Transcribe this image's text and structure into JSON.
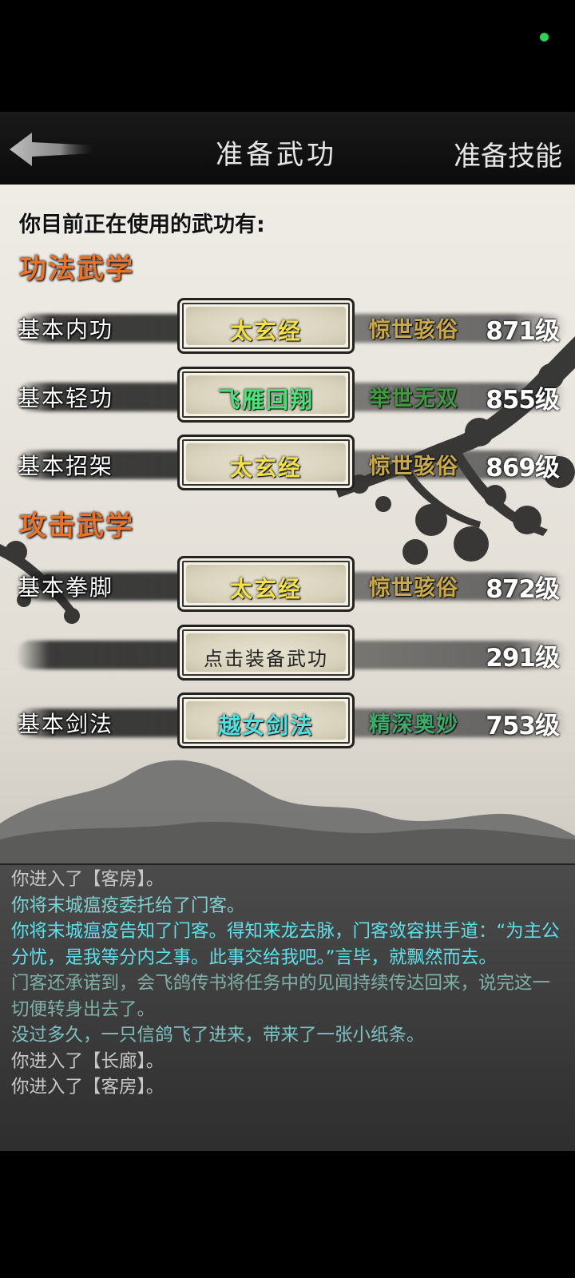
{
  "header": {
    "title": "准备武功",
    "tab_skills": "准备技能"
  },
  "intro": "你目前正在使用的武功有:",
  "sections": [
    {
      "title": "功法武学",
      "rows": [
        {
          "slot": "基本内功",
          "skill": "太玄经",
          "skill_color": "#f3e245",
          "rank": "惊世骇俗",
          "rank_color": "#c9a94a",
          "level": "871级"
        },
        {
          "slot": "基本轻功",
          "skill": "飞雁回翔",
          "skill_color": "#4ee07a",
          "rank": "举世无双",
          "rank_color": "#3f9a3f",
          "level": "855级"
        },
        {
          "slot": "基本招架",
          "skill": "太玄经",
          "skill_color": "#f3e245",
          "rank": "惊世骇俗",
          "rank_color": "#c9a94a",
          "level": "869级"
        }
      ]
    },
    {
      "title": "攻击武学",
      "rows": [
        {
          "slot": "基本拳脚",
          "skill": "太玄经",
          "skill_color": "#f3e245",
          "rank": "惊世骇俗",
          "rank_color": "#c9a94a",
          "level": "872级"
        },
        {
          "slot": "",
          "skill": "点击装备武功",
          "skill_color": "#222222",
          "rank": "",
          "rank_color": "#c9a94a",
          "level": "291级"
        },
        {
          "slot": "基本剑法",
          "skill": "越女剑法",
          "skill_color": "#52e0e0",
          "rank": "精深奥妙",
          "rank_color": "#3fa86a",
          "level": "753级"
        }
      ]
    }
  ],
  "log": [
    {
      "text": "你进入了【客房】。",
      "color": "#c8c8c8"
    },
    {
      "text": "你将末城瘟疫委托给了门客。",
      "color": "#7fd3d3"
    },
    {
      "text": "你将末城瘟疫告知了门客。得知来龙去脉，门客敛容拱手道：“为主公分忧，是我等分内之事。此事交给我吧。”言毕，就飘然而去。",
      "color": "#5ee0ea"
    },
    {
      "text": "门客还承诺到，会飞鸽传书将任务中的见闻持续传达回来，说完这一切便转身出去了。",
      "color": "#7fb0a8"
    },
    {
      "text": "没过多久，一只信鸽飞了进来，带来了一张小纸条。",
      "color": "#7fc0c0"
    },
    {
      "text": "你进入了【长廊】。",
      "color": "#c8c8c8"
    },
    {
      "text": "你进入了【客房】。",
      "color": "#c8c8c8"
    }
  ],
  "colors": {
    "section_title": "#e8732c",
    "status_dot": "#2fd05a"
  }
}
